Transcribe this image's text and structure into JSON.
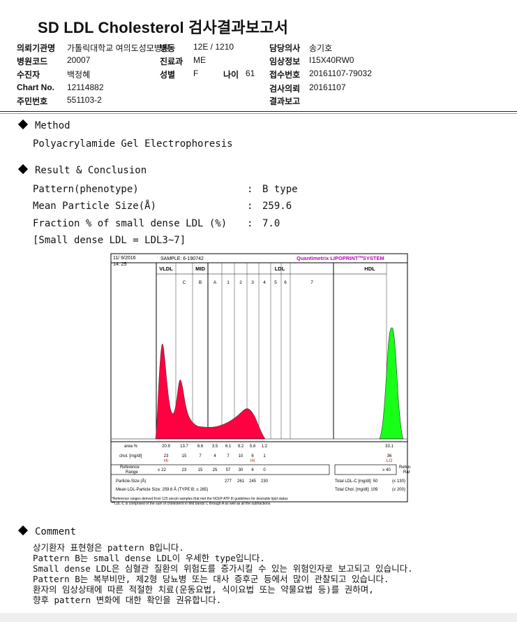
{
  "title": "SD LDL Cholesterol 검사결과보고서",
  "header": {
    "hospital_label": "의뢰기관명",
    "hospital": "가톨릭대학교 여의도성모병원",
    "ward_label": "병동",
    "ward": "12E / 1210",
    "doctor_label": "담당의사",
    "doctor": "송기호",
    "hospcode_label": "병원코드",
    "hospcode": "20007",
    "dept_label": "진료과",
    "dept": "ME",
    "clinical_label": "임상정보",
    "clinical": "I15X40RW0",
    "patient_label": "수진자",
    "patient": "백정혜",
    "sex_label": "성별",
    "sex": "F",
    "age_label": "나이",
    "age": "61",
    "receipt_label": "접수번호",
    "receipt": "20161107-79032",
    "chart_label": "Chart No.",
    "chart": "12114882",
    "request_label": "검사의뢰",
    "request": "20161107",
    "rrn_label": "주민번호",
    "rrn": "551103-2",
    "report_label": "결과보고",
    "report": ""
  },
  "method": {
    "heading": "Method",
    "text": "Polyacrylamide Gel Electrophoresis"
  },
  "result": {
    "heading": "Result & Conclusion",
    "rows": [
      {
        "label": "Pattern(phenotype)",
        "sep": ":",
        "value": "B type"
      },
      {
        "label": "Mean Particle Size(Å)",
        "sep": ":",
        "value": "259.6"
      },
      {
        "label": "Fraction % of small dense LDL (%)",
        "sep": ":",
        "value": "7.0"
      }
    ],
    "note": "[Small dense LDL = LDL3~7]"
  },
  "chart_data": {
    "type": "area",
    "date": "11/ 9/2016",
    "time": "14: 25",
    "sample": "SAMPLE:   6-190742",
    "brand": "Quantimetrix LIPOPRINT",
    "brand_tm": "TM",
    "brand_suffix": "SYSTEM",
    "groups": [
      "VLDL",
      "MID",
      "LDL",
      "HDL"
    ],
    "bands": [
      "C",
      "B",
      "A",
      "1",
      "2",
      "3",
      "4",
      "5",
      "6",
      "7"
    ],
    "row_area_label": "area %",
    "area": [
      "20.9",
      "13.7",
      "6.6",
      "3.5",
      "6.1",
      "9.2",
      "5.8",
      "1.2",
      "",
      "",
      "",
      "33.1"
    ],
    "row_chol_label": "chol. [mg/dl]",
    "chol": [
      "23",
      "15",
      "7",
      "4",
      "7",
      "10",
      "6",
      "1",
      "",
      "",
      "",
      "36"
    ],
    "chol_flags": [
      "HI",
      "",
      "",
      "",
      "",
      "",
      "HI",
      "",
      "",
      "",
      "",
      "LO"
    ],
    "ref_label_1": "Reference",
    "ref_label_2": "Range",
    "ref": [
      "≤ 22",
      "23",
      "15",
      "25",
      "57",
      "30",
      "6",
      "0"
    ],
    "ref_hdl": "≥ 40",
    "particle_label": "Particle-Size (Å)",
    "particle": [
      "277",
      "261",
      "245",
      "230"
    ],
    "mean_size": "Mean LDL-Particle Size:   259.6 Å (TYPE B; ≤ 265)",
    "total_ldl": "Total LDL-C [mg/dl]:  50",
    "total_ldl_ref": "(≤ 130)",
    "total_chol": "Total Chol. [mg/dl]:  109",
    "total_chol_ref": "(≤ 200)",
    "footnote1": "*Reference ranges derived from 125 serum samples that met the NCEP ATP III guidelines for desirable lipid status",
    "footnote2": "**LDL-C is comprised of the sum of cholesterol in Mid bands C through A as well as all the subfractions"
  },
  "comment": {
    "heading": "Comment",
    "lines": [
      "상기환자 표현형은 pattern B입니다.",
      "Pattern B는 small dense LDL이 우세한 type입니다.",
      "Small dense LDL은 심혈관 질환의 위험도를 증가시킬 수 있는 위험인자로 보고되고 있습니다.",
      "Pattern B는 복부비만, 제2형 당뇨병 또는 대사 증후군 등에서 많이 관찰되고 있습니다.",
      "환자의 임상상태에 따른 적절한 치료(운동요법, 식이요법 또는 약물요법 등)를 권하며,",
      "향후 pattern 변화에 대한 확인을 권유합니다."
    ]
  }
}
